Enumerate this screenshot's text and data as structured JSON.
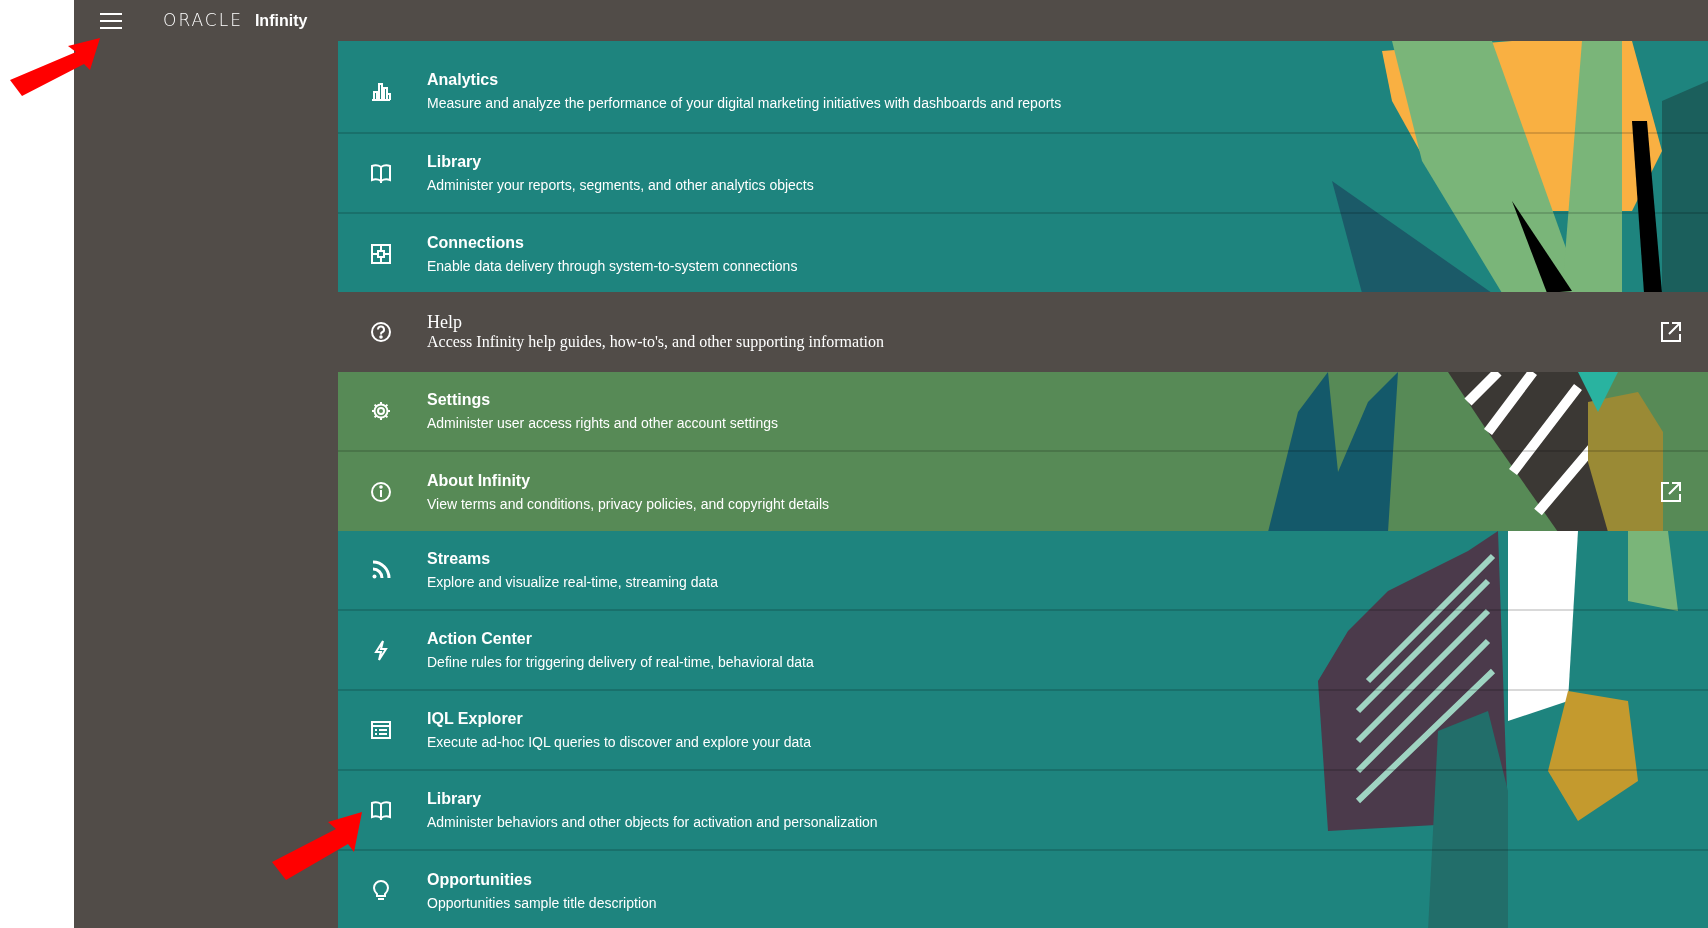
{
  "header": {
    "logo": "ORACLE",
    "product": "Infinity"
  },
  "sections": [
    {
      "kind": "teal",
      "items": [
        {
          "title": "Analytics",
          "description": "Measure and analyze the performance of your digital marketing initiatives with dashboards and reports",
          "external": false
        },
        {
          "title": "Library",
          "description": "Administer your reports, segments, and other analytics objects",
          "external": false
        },
        {
          "title": "Connections",
          "description": "Enable data delivery through system-to-system connections",
          "external": false
        }
      ]
    },
    {
      "kind": "dark",
      "items": [
        {
          "title": "Help",
          "description": "Access Infinity help guides, how-to's, and other supporting information",
          "external": true
        }
      ]
    },
    {
      "kind": "green",
      "items": [
        {
          "title": "Settings",
          "description": "Administer user access rights and other account settings",
          "external": false
        },
        {
          "title": "About Infinity",
          "description": "View terms and conditions, privacy policies, and copyright details",
          "external": true
        }
      ]
    },
    {
      "kind": "teal2",
      "items": [
        {
          "title": "Streams",
          "description": "Explore and visualize real-time, streaming data",
          "external": false
        },
        {
          "title": "Action Center",
          "description": "Define rules for triggering delivery of real-time, behavioral data",
          "external": false
        },
        {
          "title": "IQL Explorer",
          "description": "Execute ad-hoc IQL queries to discover and explore your data",
          "external": false
        },
        {
          "title": "Library",
          "description": "Administer behaviors and other objects for activation and personalization",
          "external": false
        },
        {
          "title": "Opportunities",
          "description": "Opportunities sample title description",
          "external": false
        }
      ]
    }
  ]
}
